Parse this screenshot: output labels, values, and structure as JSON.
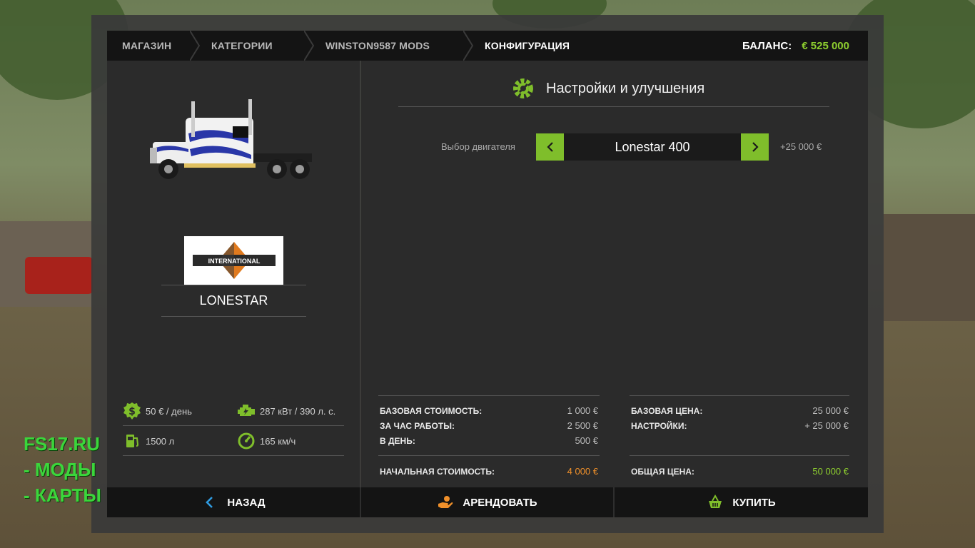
{
  "breadcrumb": {
    "items": [
      "МАГАЗИН",
      "КАТЕГОРИИ",
      "WINSTON9587 MODS",
      "КОНФИГУРАЦИЯ"
    ]
  },
  "balance": {
    "label": "БАЛАНС:",
    "value": "€ 525 000"
  },
  "vehicle": {
    "name": "LONESTAR",
    "brand_logo_text": "INTERNATIONAL"
  },
  "stats": {
    "daily_cost": "50 € / день",
    "power": "287 кВт / 390 л. с.",
    "fuel": "1500 л",
    "speed": "165 км/ч"
  },
  "config": {
    "title": "Настройки и улучшения",
    "option_label": "Выбор двигателя",
    "option_value": "Lonestar 400",
    "option_price": "+25 000 €"
  },
  "lease": {
    "base_label": "БАЗОВАЯ СТОИМОСТЬ:",
    "base_value": "1 000 €",
    "hour_label": "ЗА ЧАС РАБОТЫ:",
    "hour_value": "2 500 €",
    "day_label": "В ДЕНЬ:",
    "day_value": "500 €",
    "initial_label": "НАЧАЛЬНАЯ СТОИМОСТЬ:",
    "initial_value": "4 000 €"
  },
  "purchase": {
    "base_label": "БАЗОВАЯ ЦЕНА:",
    "base_value": "25 000 €",
    "config_label": "НАСТРОЙКИ:",
    "config_value": "+ 25 000 €",
    "total_label": "ОБЩАЯ ЦЕНА:",
    "total_value": "50 000 €"
  },
  "buttons": {
    "back": "НАЗАД",
    "lease": "АРЕНДОВАТЬ",
    "buy": "КУПИТЬ"
  },
  "watermark": {
    "line1": "FS17.RU",
    "line2": "- МОДЫ",
    "line3": "- КАРТЫ"
  },
  "colors": {
    "accent": "#7fbe2b",
    "balance": "#8ecf2f",
    "lease_total": "#f0902a",
    "purchase_total": "#8ecf2f"
  }
}
